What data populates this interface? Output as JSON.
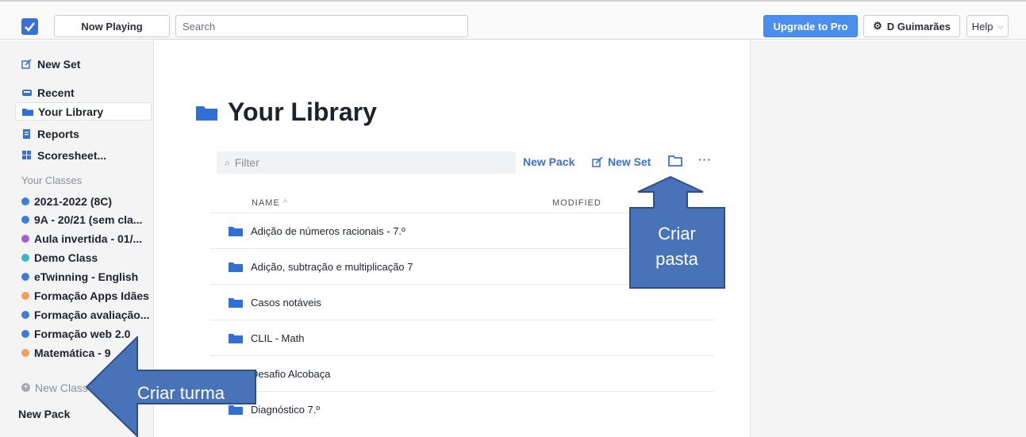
{
  "topbar": {
    "now_playing": "Now Playing",
    "search_placeholder": "Search",
    "upgrade": "Upgrade to Pro",
    "user": "D Guimarães",
    "help": "Help"
  },
  "sidebar": {
    "new_set": "New Set",
    "recent": "Recent",
    "your_library": "Your Library",
    "reports": "Reports",
    "scoresheet": "Scoresheet...",
    "your_classes_header": "Your Classes",
    "classes": [
      {
        "label": "2021-2022 (8C)",
        "color": "#3b7ddd"
      },
      {
        "label": "9A - 20/21 (sem cla...",
        "color": "#3b7ddd"
      },
      {
        "label": "Aula invertida - 01/...",
        "color": "#a25fd6"
      },
      {
        "label": "Demo Class",
        "color": "#3bb6c4"
      },
      {
        "label": "eTwinning - English",
        "color": "#3b7ddd"
      },
      {
        "label": "Formação Apps Idães",
        "color": "#f0a05a"
      },
      {
        "label": "Formação avaliação...",
        "color": "#3b7ddd"
      },
      {
        "label": "Formação web 2.0",
        "color": "#3b7ddd"
      },
      {
        "label": "Matemática - 9",
        "color": "#f0a05a"
      }
    ],
    "new_class": "New Class",
    "new_pack": "New Pack"
  },
  "main": {
    "title": "Your Library",
    "filter_placeholder": "Filter",
    "new_pack": "New Pack",
    "new_set": "New Set",
    "col_name": "NAME",
    "col_modified": "MODIFIED",
    "rows": [
      "Adição de números racionais - 7.º",
      "Adição, subtração e multiplicação 7",
      "Casos notáveis",
      "CLIL - Math",
      "Desafio Alcobaça",
      "Diagnóstico 7.º"
    ]
  },
  "annotations": {
    "folder_line1": "Criar",
    "folder_line2": "pasta",
    "class_callout": "Criar turma"
  },
  "colors": {
    "accent": "#3b6fd8",
    "upgrade": "#4a8ff0",
    "callout_fill": "#4873b8",
    "callout_border": "#2c4f8a"
  }
}
